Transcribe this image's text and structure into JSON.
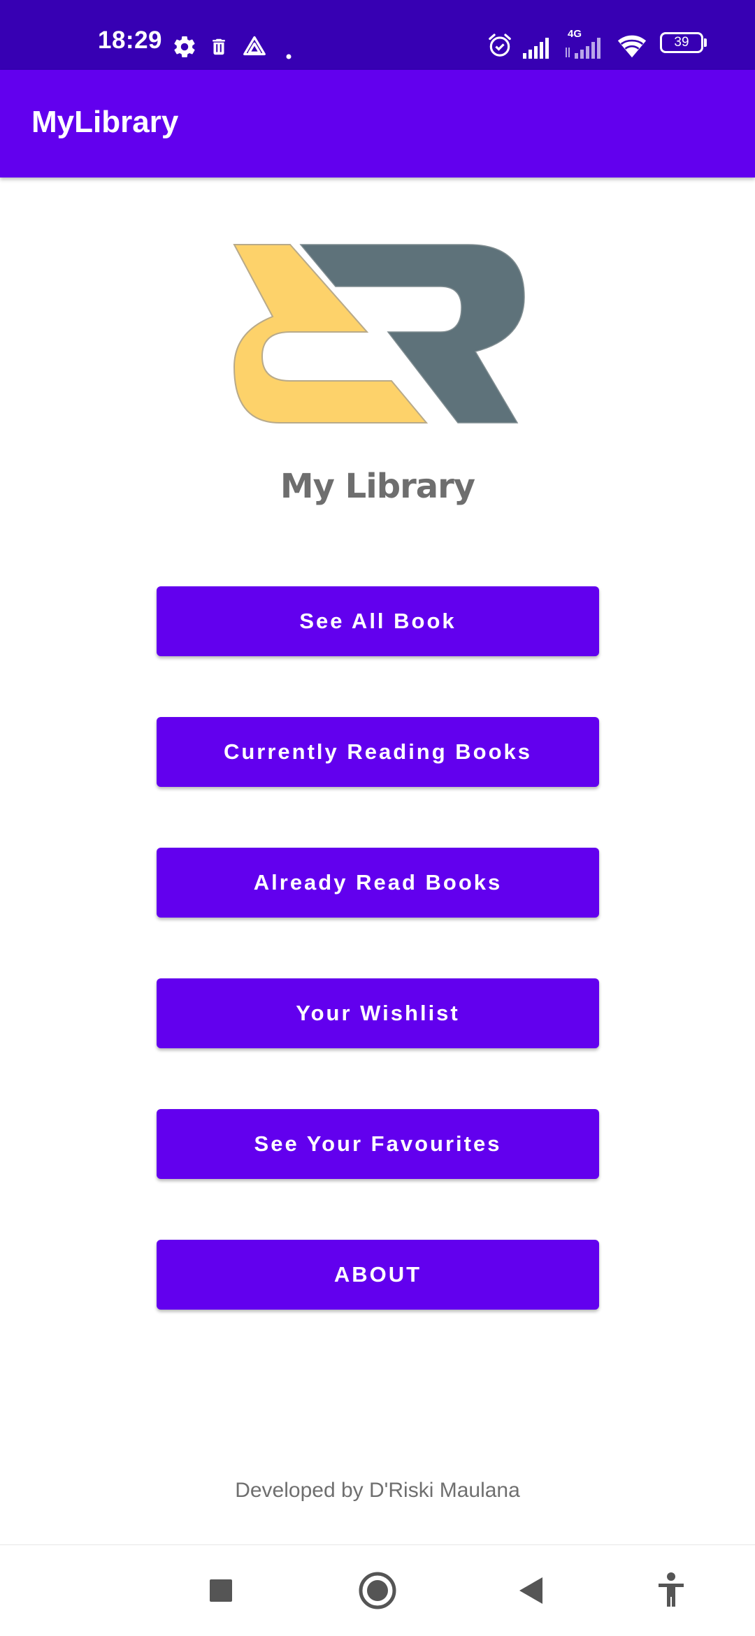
{
  "status_bar": {
    "time": "18:29",
    "battery": "39",
    "network_label": "4G",
    "icons": [
      "settings-icon",
      "trash-icon",
      "drive-icon",
      "dot-icon",
      "alarm-icon",
      "signal-icon",
      "signal-4g-icon",
      "wifi-icon",
      "battery-icon"
    ]
  },
  "app_bar": {
    "title": "MyLibrary"
  },
  "logo": {
    "title": "My Library",
    "colors": {
      "left_shape": "#fdd26a",
      "right_shape": "#5e727a"
    }
  },
  "buttons": {
    "see_all": "See All Book",
    "currently_reading": "Currently Reading Books",
    "already_read": "Already Read Books",
    "wishlist": "Your Wishlist",
    "favourites": "See Your Favourites",
    "about": "ABOUT"
  },
  "footer": {
    "text": "Developed by D'Riski Maulana"
  },
  "nav_bar": {
    "icons": [
      "recents-icon",
      "home-icon",
      "back-icon",
      "accessibility-icon"
    ]
  },
  "colors": {
    "status_bar": "#3700b3",
    "primary": "#6200ee",
    "button_text": "#ffffff",
    "muted_text": "#6f6f6f"
  }
}
